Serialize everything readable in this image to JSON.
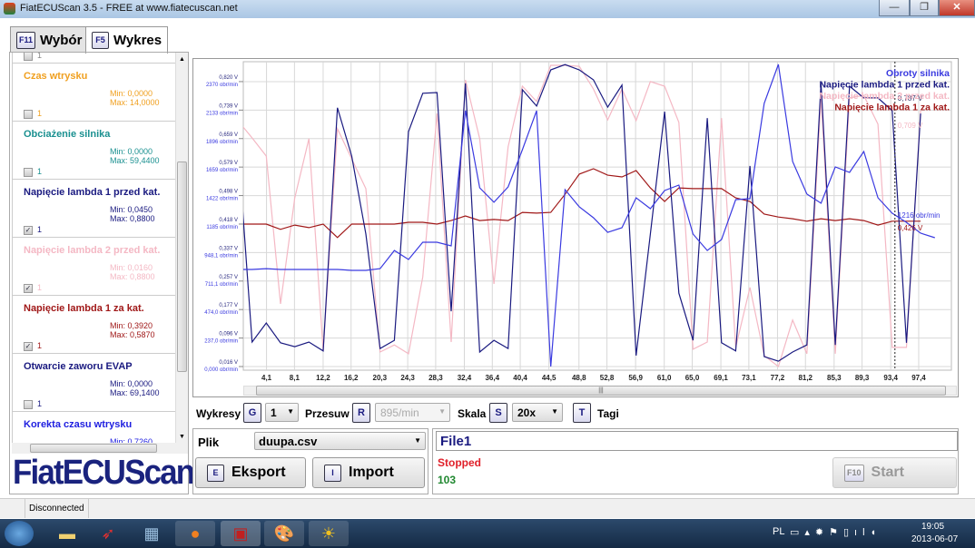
{
  "window": {
    "title": "FiatECUScan 3.5 - FREE at www.fiatecuscan.net",
    "minimize": "—",
    "maximize": "❐",
    "close": "✕"
  },
  "tabs": [
    {
      "key": "F11",
      "label": "Wybór"
    },
    {
      "key": "F5",
      "label": "Wykres"
    }
  ],
  "sensors": [
    {
      "name": "",
      "min": "",
      "max": "",
      "checked": false,
      "count": "1",
      "color": "#888888"
    },
    {
      "name": "Czas wtrysku",
      "min": "Min: 0,0000",
      "max": "Max: 14,0000",
      "checked": false,
      "count": "1",
      "color": "#f0a020"
    },
    {
      "name": "Obciażenie silnika",
      "min": "Min: 0,0000",
      "max": "Max: 59,4400",
      "checked": false,
      "count": "1",
      "color": "#1a9090"
    },
    {
      "name": "Napięcie lambda 1 przed kat.",
      "min": "Min: 0,0450",
      "max": "Max: 0,8800",
      "checked": true,
      "count": "1",
      "color": "#1a1a80"
    },
    {
      "name": "Napięcie lambda 2 przed kat.",
      "min": "Min: 0,0160",
      "max": "Max: 0,8800",
      "checked": true,
      "count": "1",
      "color": "#f4b8c4"
    },
    {
      "name": "Napięcie lambda 1 za kat.",
      "min": "Min: 0,3920",
      "max": "Max: 0,5870",
      "checked": true,
      "count": "1",
      "color": "#a01818"
    },
    {
      "name": "Otwarcie zaworu EVAP",
      "min": "Min: 0,0000",
      "max": "Max: 69,1400",
      "checked": false,
      "count": "1",
      "color": "#1a1a80"
    },
    {
      "name": "Korekta czasu wtrysku",
      "min": "Min: 0,7260",
      "max": "",
      "checked": false,
      "count": "",
      "color": "#2020e0"
    }
  ],
  "logo": "FiatECUScan",
  "controls": {
    "wykresy_label": "Wykresy",
    "wykresy_key": "G",
    "wykresy_value": "1",
    "przesuw_label": "Przesuw",
    "przesuw_key": "R",
    "przesuw_value": "895/min",
    "skala_label": "Skala",
    "skala_key": "S",
    "skala_value": "20x",
    "tagi_key": "T",
    "tagi_label": "Tagi"
  },
  "file": {
    "label": "Plik",
    "value": "duupa.csv",
    "export_key": "E",
    "export_label": "Eksport",
    "import_key": "I",
    "import_label": "Import"
  },
  "status": {
    "name": "File1",
    "state": "Stopped",
    "count": "103",
    "start_key": "F10",
    "start_label": "Start"
  },
  "statusbar": {
    "connection": "Disconnected"
  },
  "tray": {
    "lang": "PL",
    "time": "19:05",
    "date": "2013-06-07"
  },
  "chart_data": {
    "type": "line",
    "x_ticks": [
      "4,1",
      "8,1",
      "12,2",
      "16,2",
      "20,3",
      "24,3",
      "28,3",
      "32,4",
      "36,4",
      "40,4",
      "44,5",
      "48,8",
      "52,8",
      "56,9",
      "61,0",
      "65,0",
      "69,1",
      "73,1",
      "77,2",
      "81,2",
      "85,3",
      "89,3",
      "93,4",
      "97,4"
    ],
    "x_tick_values": [
      4.1,
      8.1,
      12.2,
      16.2,
      20.3,
      24.3,
      28.3,
      32.4,
      36.4,
      40.4,
      44.5,
      48.8,
      52.8,
      56.9,
      61.0,
      65.0,
      69.1,
      73.1,
      77.2,
      81.2,
      85.3,
      89.3,
      93.4,
      97.4
    ],
    "xlim": [
      0,
      102
    ],
    "y_ticks_v": [
      "0,016 V",
      "0,096 V",
      "0,177 V",
      "0,257 V",
      "0,337 V",
      "0,418 V",
      "0,498 V",
      "0,579 V",
      "0,659 V",
      "0,739 V",
      "0,820 V"
    ],
    "y_ticks_rpm": [
      "0,000 obr/min",
      "237,0 obr/min",
      "474,0 obr/min",
      "711,1 obr/min",
      "948,1 obr/min",
      "1185 obr/min",
      "1422 obr/min",
      "1659 obr/min",
      "1896 obr/min",
      "2133 obr/min",
      "2370 obr/min"
    ],
    "ylim_v": [
      0.016,
      0.876
    ],
    "ylim_rpm": [
      0,
      2536
    ],
    "x_step": 2.035,
    "legend_position": "top-right",
    "series": [
      {
        "name": "Obroty silnika",
        "unit": "rpm",
        "color": "#3a3ae0",
        "values": [
          808,
          808,
          815,
          808,
          808,
          808,
          808,
          808,
          800,
          800,
          815,
          966,
          891,
          1034,
          1034,
          1004,
          2129,
          1487,
          1367,
          1495,
          1804,
          2129,
          0,
          1472,
          1329,
          1238,
          1117,
          1155,
          1404,
          1314,
          1465,
          1510,
          1102,
          966,
          1057,
          1389,
          1397,
          2190,
          2514,
          1706,
          1435,
          1359,
          1661,
          1616,
          1789,
          1404,
          1276,
          1200,
          1110,
          1072
        ]
      },
      {
        "name": "Napięcie lambda 1 przed kat.",
        "unit": "V",
        "color": "#1a1a80",
        "values": [
          0.648,
          0.085,
          0.139,
          0.083,
          0.072,
          0.085,
          0.06,
          0.746,
          0.61,
          0.39,
          0.067,
          0.09,
          0.679,
          0.787,
          0.789,
          0.172,
          0.815,
          0.057,
          0.09,
          0.067,
          0.797,
          0.751,
          0.853,
          0.868,
          0.853,
          0.825,
          0.748,
          0.81,
          0.047,
          0.39,
          0.735,
          0.223,
          0.09,
          0.717,
          0.083,
          0.06,
          0.582,
          0.044,
          0.031,
          0.057,
          0.077,
          0.815,
          0.077,
          0.807,
          0.774,
          0.774,
          0.738,
          0.083,
          0.73
        ]
      },
      {
        "name": "Napięcie lambda 2 przed kat.",
        "unit": "V",
        "color": "#f4b8c4",
        "values": [
          0.71,
          0.661,
          0.61,
          0.193,
          0.492,
          0.659,
          0.06,
          0.687,
          0.602,
          0.518,
          0.057,
          0.077,
          0.052,
          0.269,
          0.73,
          0.085,
          0.825,
          0.659,
          0.249,
          0.636,
          0.807,
          0.764,
          0.866,
          0.866,
          0.863,
          0.799,
          0.712,
          0.799,
          0.71,
          0.82,
          0.807,
          0.705,
          0.065,
          0.085,
          0.717,
          0.07,
          0.239,
          0.047,
          0.016,
          0.147,
          0.052,
          0.776,
          0.052,
          0.774,
          0.781,
          0.7,
          0.07,
          0.07,
          0.738
        ]
      },
      {
        "name": "Napięcie lambda 1 za kat.",
        "unit": "V",
        "color": "#a01818",
        "values": [
          0.418,
          0.418,
          0.418,
          0.403,
          0.415,
          0.408,
          0.418,
          0.38,
          0.418,
          0.418,
          0.418,
          0.418,
          0.423,
          0.423,
          0.418,
          0.428,
          0.441,
          0.428,
          0.431,
          0.428,
          0.451,
          0.449,
          0.451,
          0.502,
          0.559,
          0.574,
          0.556,
          0.551,
          0.569,
          0.52,
          0.482,
          0.52,
          0.518,
          0.518,
          0.518,
          0.492,
          0.482,
          0.446,
          0.438,
          0.433,
          0.426,
          0.433,
          0.428,
          0.433,
          0.428,
          0.415,
          0.426,
          0.426,
          0.426
        ]
      }
    ],
    "cursor": {
      "x": 94.0,
      "labels": [
        {
          "text": "0,787 V",
          "color": "#333366",
          "value": 0.787,
          "unit": "V"
        },
        {
          "text": "0,709 V",
          "color": "#f4b8c4",
          "value": 0.709,
          "unit": "V"
        },
        {
          "text": "1216 obr/min",
          "color": "#3a3ae0",
          "value": 1216,
          "unit": "rpm"
        },
        {
          "text": "0,426 V",
          "color": "#a01818",
          "value": 0.426,
          "unit": "V"
        }
      ]
    }
  }
}
